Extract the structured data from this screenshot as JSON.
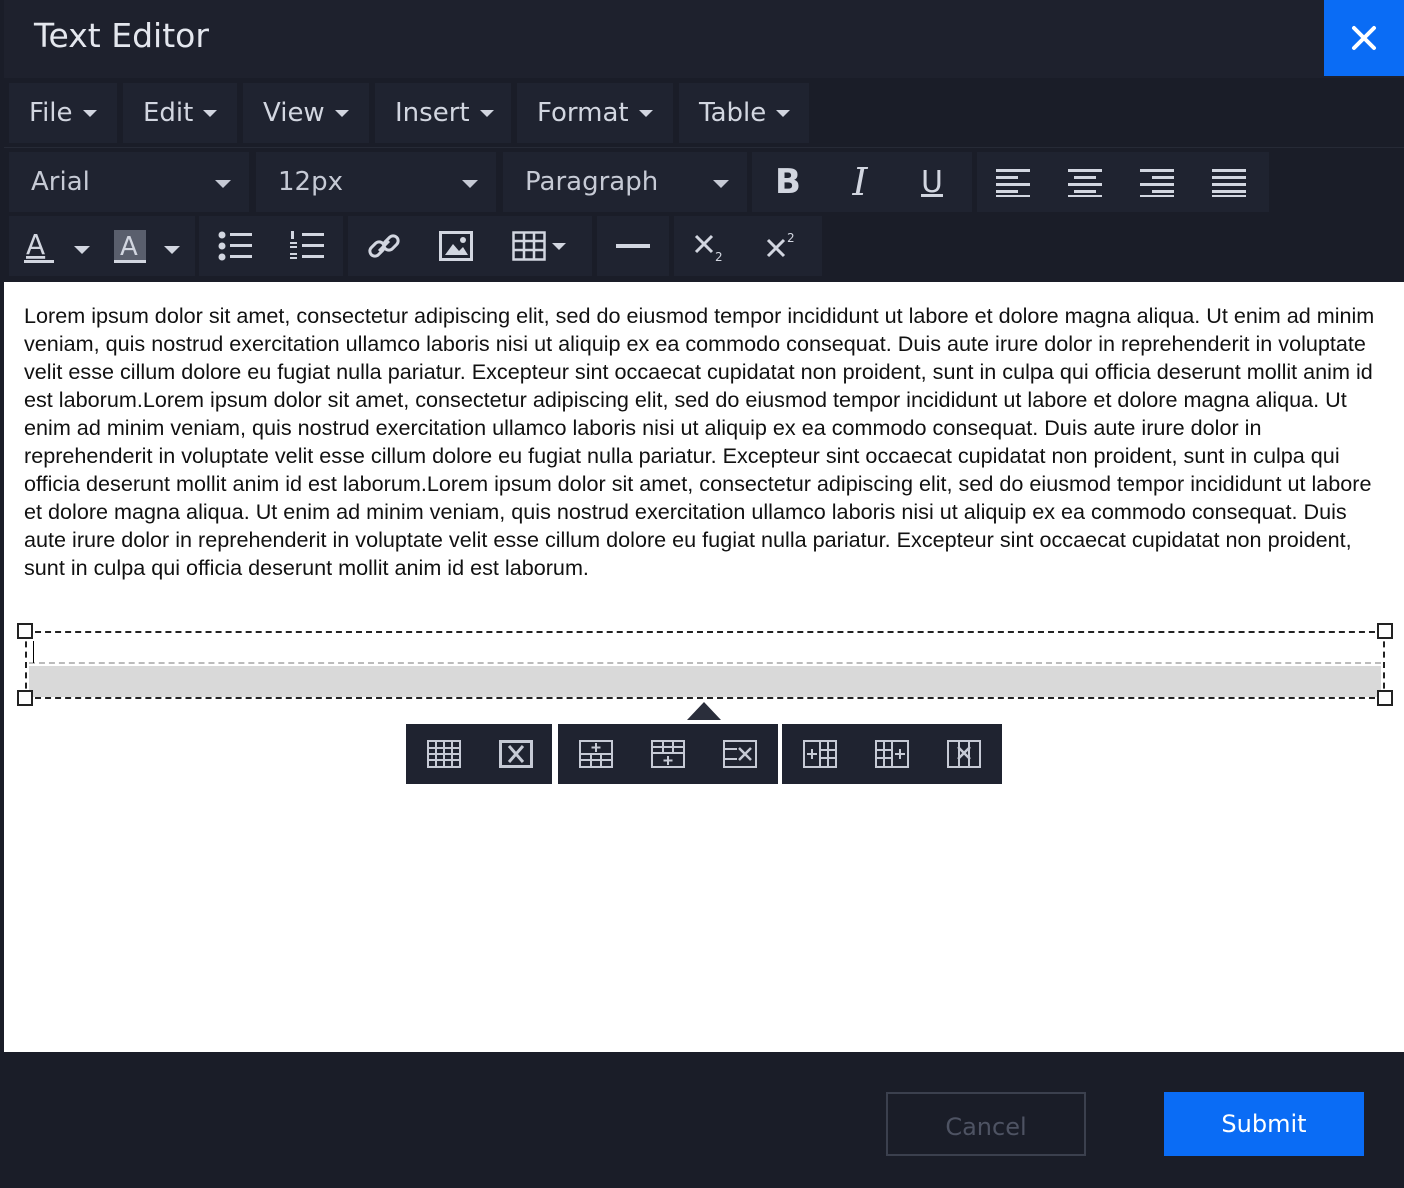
{
  "window": {
    "title": "Text Editor"
  },
  "menubar": {
    "items": [
      {
        "label": "File"
      },
      {
        "label": "Edit"
      },
      {
        "label": "View"
      },
      {
        "label": "Insert"
      },
      {
        "label": "Format"
      },
      {
        "label": "Table"
      }
    ]
  },
  "toolbar": {
    "font_family": "Arial",
    "font_size": "12px",
    "block_format": "Paragraph",
    "text_buttons": {
      "bold": "B",
      "italic": "I",
      "underline": "U"
    }
  },
  "content": {
    "paragraph": "Lorem ipsum dolor sit amet, consectetur adipiscing elit, sed do eiusmod tempor incididunt ut labore et dolore magna aliqua. Ut enim ad minim veniam, quis nostrud exercitation ullamco laboris nisi ut aliquip ex ea commodo consequat. Duis aute irure dolor in reprehenderit in voluptate velit esse cillum dolore eu fugiat nulla pariatur. Excepteur sint occaecat cupidatat non proident, sunt in culpa qui officia deserunt mollit anim id est laborum.Lorem ipsum dolor sit amet, consectetur adipiscing elit, sed do eiusmod tempor incididunt ut labore et dolore magna aliqua. Ut enim ad minim veniam, quis nostrud exercitation ullamco laboris nisi ut aliquip ex ea commodo consequat. Duis aute irure dolor in reprehenderit in voluptate velit esse cillum dolore eu fugiat nulla pariatur. Excepteur sint occaecat cupidatat non proident, sunt in culpa qui officia deserunt mollit anim id est laborum.Lorem ipsum dolor sit amet, consectetur adipiscing elit, sed do eiusmod tempor incididunt ut labore et dolore magna aliqua. Ut enim ad minim veniam, quis nostrud exercitation ullamco laboris nisi ut aliquip ex ea commodo consequat. Duis aute irure dolor in reprehenderit in voluptate velit esse cillum dolore eu fugiat nulla pariatur. Excepteur sint occaecat cupidatat non proident, sunt in culpa qui officia deserunt mollit anim id est laborum."
  },
  "footer": {
    "cancel_label": "Cancel",
    "submit_label": "Submit"
  },
  "colors": {
    "accent": "#0a6cf5",
    "panel": "#1f2330",
    "background": "#1a1d28"
  }
}
